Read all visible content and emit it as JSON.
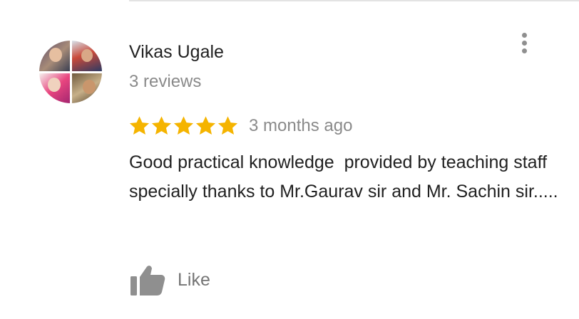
{
  "review": {
    "reviewer_name": "Vikas Ugale",
    "review_count": "3 reviews",
    "rating": 5,
    "rating_max": 5,
    "date": "3 months ago",
    "text": "Good practical knowledge  provided by teaching staff specially thanks to Mr.Gaurav sir and Mr. Sachin sir.....",
    "like_label": "Like"
  },
  "icons": {
    "more": "more-vert-icon",
    "star": "star-icon",
    "like": "thumbs-up-icon"
  },
  "colors": {
    "star": "#F5B400",
    "primary_text": "#212121",
    "secondary_text": "#8A8A8A",
    "icon_gray": "#8F8F8F"
  }
}
